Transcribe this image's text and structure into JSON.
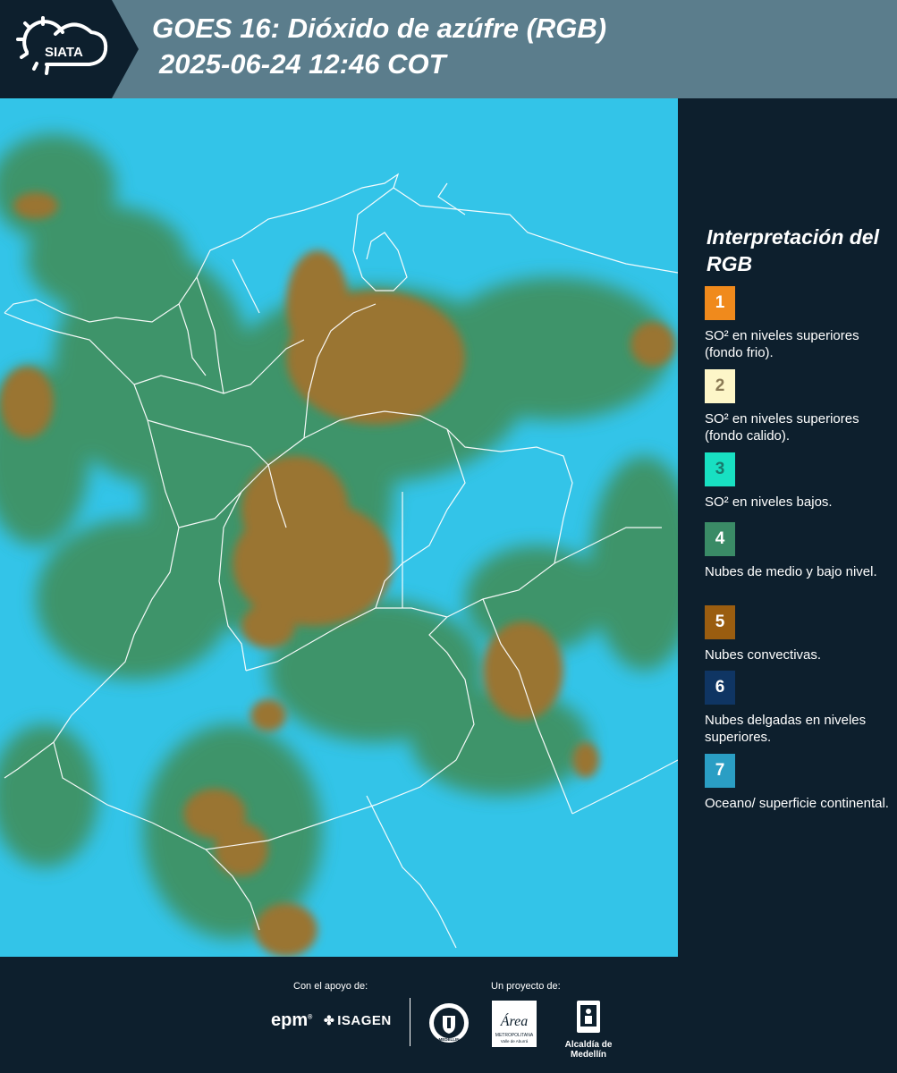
{
  "header": {
    "logo_text": "SIATA",
    "title_line1": "GOES 16: Dióxido de azúfre (RGB)",
    "title_line2": "2025-06-24 12:46 COT"
  },
  "legend": {
    "title": "Interpretación del RGB",
    "items": [
      {
        "number": "1",
        "label": "SO² en niveles superiores (fondo frio).",
        "color": "#f08a1c",
        "text_color": "#ffffff"
      },
      {
        "number": "2",
        "label": "SO² en niveles superiores (fondo calido).",
        "color": "#fdf6c8",
        "text_color": "#8a7a55"
      },
      {
        "number": "3",
        "label": "SO² en niveles bajos.",
        "color": "#18e0c2",
        "text_color": "#177a6c"
      },
      {
        "number": "4",
        "label": "Nubes de medio y bajo nivel.",
        "color": "#3a8b66",
        "text_color": "#ffffff"
      },
      {
        "number": "5",
        "label": "Nubes convectivas.",
        "color": "#9a5d10",
        "text_color": "#ffffff"
      },
      {
        "number": "6",
        "label": "Nubes delgadas en niveles superiores.",
        "color": "#0f3563",
        "text_color": "#ffffff"
      },
      {
        "number": "7",
        "label": "Oceano/ superficie continental.",
        "color": "#2a9ec4",
        "text_color": "#ffffff"
      }
    ]
  },
  "map": {
    "ocean_color": "#33c4e8",
    "boundary_color": "#ffffff",
    "cloud_colors": {
      "convective": "#9a7530",
      "mid_low": "#3f8c55"
    }
  },
  "footer": {
    "support_label": "Con el apoyo de:",
    "project_label": "Un proyecto de:",
    "epm": "epm",
    "isagen": "ISAGEN",
    "area_text": "Área",
    "area_sub": "METROPOLITANA",
    "area_sub2": "Valle de Aburrá",
    "seal_text": "MEDELLIN",
    "alcaldia": "Alcaldía de Medellín"
  }
}
